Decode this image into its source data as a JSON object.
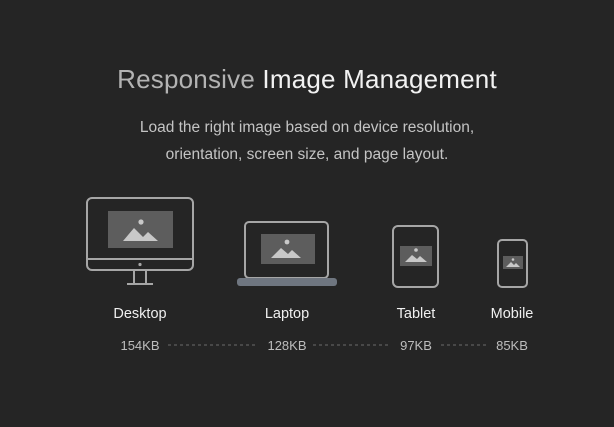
{
  "heading": {
    "light_word": "Responsive",
    "strong_words": "Image Management"
  },
  "subtitle": {
    "line1": "Load the right image based on device resolution,",
    "line2": "orientation, screen size, and page layout."
  },
  "devices": [
    {
      "label": "Desktop",
      "size": "154KB",
      "icon": "desktop-icon"
    },
    {
      "label": "Laptop",
      "size": "128KB",
      "icon": "laptop-icon"
    },
    {
      "label": "Tablet",
      "size": "97KB",
      "icon": "tablet-icon"
    },
    {
      "label": "Mobile",
      "size": "85KB",
      "icon": "mobile-icon"
    }
  ],
  "colors": {
    "background": "#252525",
    "device_outline": "#a6a6a6",
    "screen_fill": "#5d5d5d",
    "image_glyph": "#c8c8c8",
    "laptop_base": "#6f7680",
    "connector": "#6a6a6a"
  }
}
